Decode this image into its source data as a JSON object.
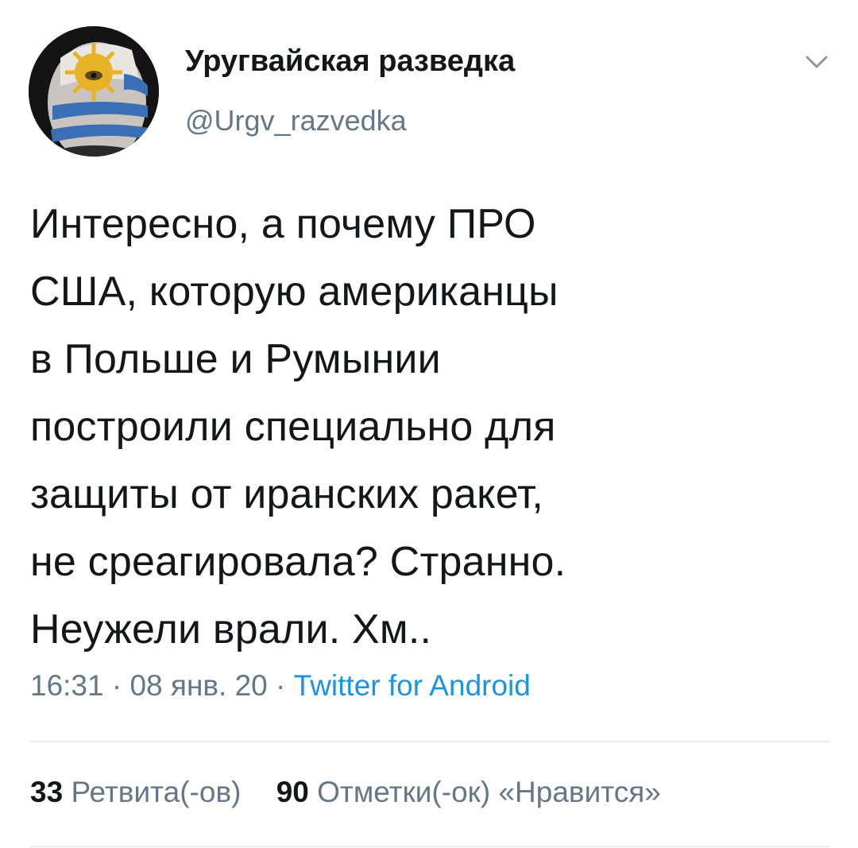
{
  "user": {
    "display_name": "Уругвайская разведка",
    "handle": "@Urgv_razvedka",
    "avatar_icon": "uruguay-face-paint-avatar"
  },
  "tweet": {
    "lines": [
      "Интересно, а почему ПРО",
      "США, которую американцы",
      "в Польше и Румынии",
      "построили специально для",
      "защиты от иранских ракет,",
      "не среагировала? Странно.",
      "Неужели врали. Хм.."
    ]
  },
  "meta": {
    "time": "16:31",
    "separator": "·",
    "date": "08 янв. 20",
    "source": "Twitter for Android"
  },
  "stats": {
    "retweets_count": "33",
    "retweets_label": "Ретвита(-ов)",
    "likes_count": "90",
    "likes_label": "Отметки(-ок) «Нравится»"
  },
  "colors": {
    "text": "#14171a",
    "secondary": "#657786",
    "link": "#1b95e0",
    "divider": "#e6ecf0"
  },
  "icons": {
    "caret": "chevron-down-icon"
  }
}
